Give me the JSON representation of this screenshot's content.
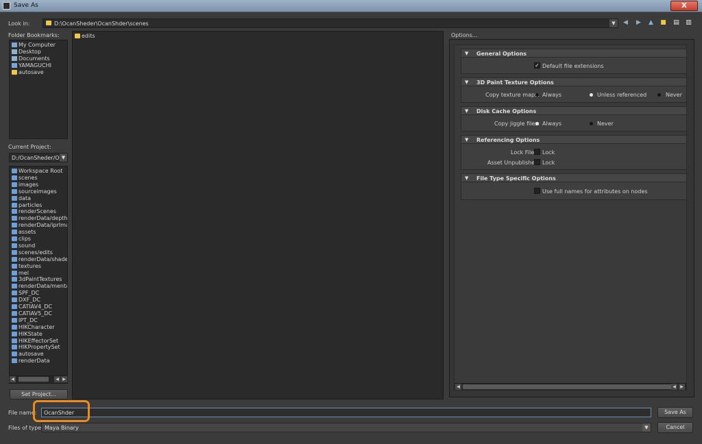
{
  "window": {
    "title": "Save As",
    "close_label": "X"
  },
  "look_in": {
    "label": "Look in:",
    "path": "D:\\OcanSheder\\OcanShder\\scenes"
  },
  "bookmarks": {
    "label": "Folder Bookmarks:",
    "items": [
      {
        "icon": "computer-icon",
        "label": "My Computer"
      },
      {
        "icon": "folder-icon",
        "label": "Desktop"
      },
      {
        "icon": "document-icon",
        "label": "Documents"
      },
      {
        "icon": "user-icon",
        "label": "YAMAGUCHI"
      },
      {
        "icon": "folder-icon",
        "label": "autosave"
      }
    ]
  },
  "project": {
    "label": "Current Project:",
    "value": "D:/OcanSheder/Ocan",
    "items": [
      "Workspace Root",
      "scenes",
      "images",
      "sourceimages",
      "data",
      "particles",
      "renderScenes",
      "renderData/depth",
      "renderData/iprImages",
      "assets",
      "clips",
      "sound",
      "scenes/edits",
      "renderData/shaders",
      "textures",
      "mel",
      "3dPaintTextures",
      "renderData/mentalray",
      "SPF_DC",
      "DXF_DC",
      "CATIAV4_DC",
      "CATIAV5_DC",
      "IPT_DC",
      "HIKCharacter",
      "HIKState",
      "HIKEffectorSet",
      "HIKPropertySet",
      "autosave",
      "renderData"
    ],
    "set_button": "Set Project..."
  },
  "files": {
    "items": [
      {
        "icon": "folder-icon",
        "label": "edits"
      }
    ]
  },
  "options": {
    "label": "Options...",
    "general": {
      "title": "General Options",
      "default_ext": "Default file extensions"
    },
    "paint": {
      "title": "3D Paint Texture Options",
      "copy_label": "Copy texture maps:",
      "always": "Always",
      "unless": "Unless referenced",
      "never": "Never"
    },
    "cache": {
      "title": "Disk Cache Options",
      "copy_label": "Copy jiggle files:",
      "always": "Always",
      "never": "Never"
    },
    "referencing": {
      "title": "Referencing Options",
      "lock_file_label": "Lock File:",
      "lock": "Lock",
      "asset_label": "Asset Unpublished:",
      "lock2": "Lock"
    },
    "filetype": {
      "title": "File Type Specific Options",
      "fullnames": "Use full names for attributes on nodes"
    }
  },
  "bottom": {
    "filename_label": "File name:",
    "filename_value": "OcanShder",
    "type_label": "Files of type:",
    "type_value": "Maya Binary",
    "save_button": "Save As",
    "cancel_button": "Cancel"
  }
}
